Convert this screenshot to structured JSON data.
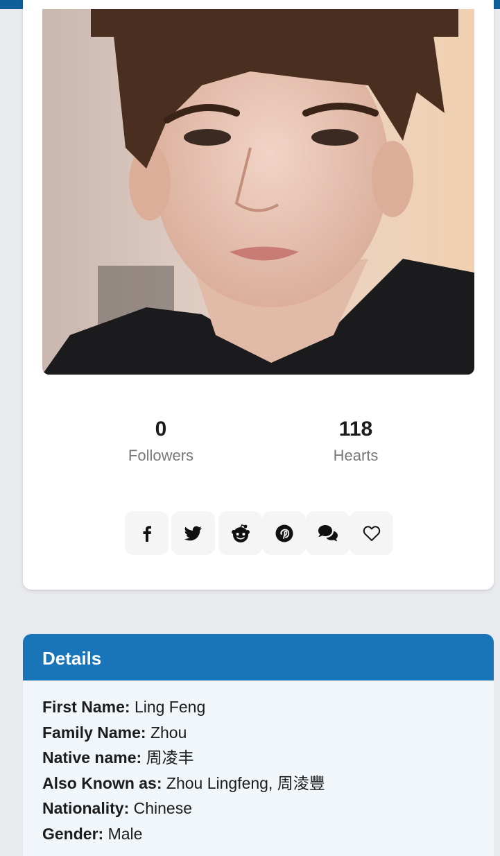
{
  "stats": {
    "followers": {
      "value": "0",
      "label": "Followers"
    },
    "hearts": {
      "value": "118",
      "label": "Hearts"
    }
  },
  "share_buttons": [
    {
      "name": "facebook",
      "icon": "facebook-icon"
    },
    {
      "name": "twitter",
      "icon": "twitter-icon"
    },
    {
      "name": "reddit",
      "icon": "reddit-icon"
    },
    {
      "name": "pinterest",
      "icon": "pinterest-icon"
    },
    {
      "name": "comments",
      "icon": "comments-icon"
    },
    {
      "name": "favorite",
      "icon": "heart-icon"
    }
  ],
  "details": {
    "title": "Details",
    "rows": [
      {
        "label": "First Name:",
        "value": "Ling Feng"
      },
      {
        "label": "Family Name:",
        "value": "Zhou"
      },
      {
        "label": "Native name:",
        "value": "周凌丰"
      },
      {
        "label": "Also Known as:",
        "value": "Zhou Lingfeng, 周淩豐"
      },
      {
        "label": "Nationality:",
        "value": "Chinese"
      },
      {
        "label": "Gender:",
        "value": "Male"
      }
    ]
  },
  "colors": {
    "topbar": "#0f5f9b",
    "details_header": "#1a74b8",
    "page_background": "#e9eaee",
    "details_background": "#f1f6fa"
  }
}
